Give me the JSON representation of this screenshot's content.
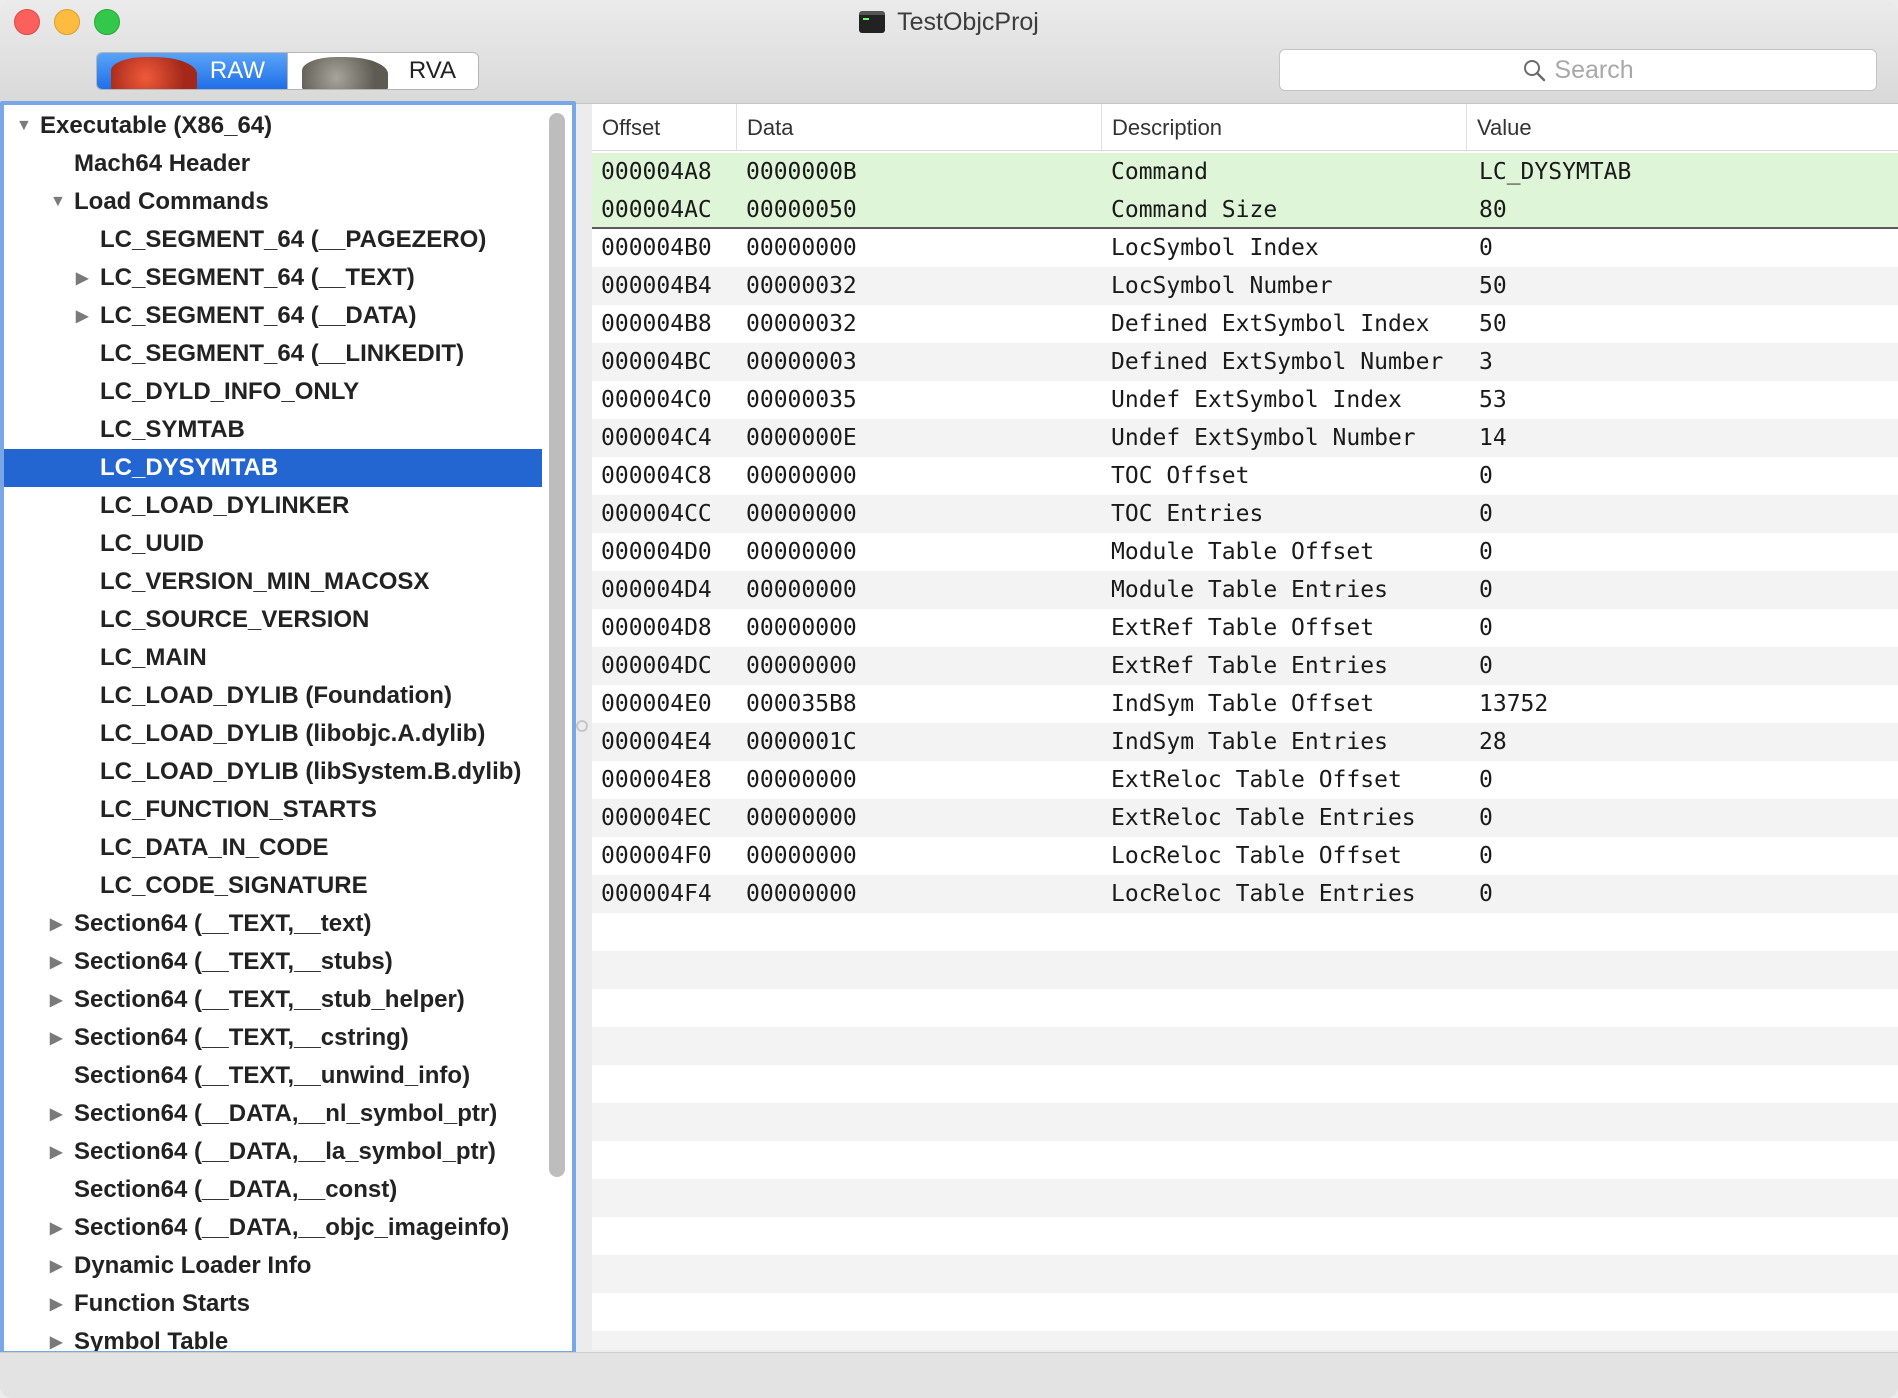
{
  "window": {
    "title": "TestObjcProj"
  },
  "toolbar": {
    "raw_label": "RAW",
    "rva_label": "RVA",
    "search_placeholder": "Search"
  },
  "sidebar": {
    "selected_index": 9,
    "items": [
      {
        "label": "Executable  (X86_64)",
        "level": 0,
        "disclosure": "expanded"
      },
      {
        "label": "Mach64 Header",
        "level": 1,
        "disclosure": "none"
      },
      {
        "label": "Load Commands",
        "level": 1,
        "disclosure": "expanded"
      },
      {
        "label": "LC_SEGMENT_64 (__PAGEZERO)",
        "level": 2,
        "disclosure": "none"
      },
      {
        "label": "LC_SEGMENT_64 (__TEXT)",
        "level": 2,
        "disclosure": "collapsed"
      },
      {
        "label": "LC_SEGMENT_64 (__DATA)",
        "level": 2,
        "disclosure": "collapsed"
      },
      {
        "label": "LC_SEGMENT_64 (__LINKEDIT)",
        "level": 2,
        "disclosure": "none"
      },
      {
        "label": "LC_DYLD_INFO_ONLY",
        "level": 2,
        "disclosure": "none"
      },
      {
        "label": "LC_SYMTAB",
        "level": 2,
        "disclosure": "none"
      },
      {
        "label": "LC_DYSYMTAB",
        "level": 2,
        "disclosure": "none"
      },
      {
        "label": "LC_LOAD_DYLINKER",
        "level": 2,
        "disclosure": "none"
      },
      {
        "label": "LC_UUID",
        "level": 2,
        "disclosure": "none"
      },
      {
        "label": "LC_VERSION_MIN_MACOSX",
        "level": 2,
        "disclosure": "none"
      },
      {
        "label": "LC_SOURCE_VERSION",
        "level": 2,
        "disclosure": "none"
      },
      {
        "label": "LC_MAIN",
        "level": 2,
        "disclosure": "none"
      },
      {
        "label": "LC_LOAD_DYLIB (Foundation)",
        "level": 2,
        "disclosure": "none"
      },
      {
        "label": "LC_LOAD_DYLIB (libobjc.A.dylib)",
        "level": 2,
        "disclosure": "none"
      },
      {
        "label": "LC_LOAD_DYLIB (libSystem.B.dylib)",
        "level": 2,
        "disclosure": "none"
      },
      {
        "label": "LC_FUNCTION_STARTS",
        "level": 2,
        "disclosure": "none"
      },
      {
        "label": "LC_DATA_IN_CODE",
        "level": 2,
        "disclosure": "none"
      },
      {
        "label": "LC_CODE_SIGNATURE",
        "level": 2,
        "disclosure": "none"
      },
      {
        "label": "Section64 (__TEXT,__text)",
        "level": 1,
        "disclosure": "collapsed"
      },
      {
        "label": "Section64 (__TEXT,__stubs)",
        "level": 1,
        "disclosure": "collapsed"
      },
      {
        "label": "Section64 (__TEXT,__stub_helper)",
        "level": 1,
        "disclosure": "collapsed"
      },
      {
        "label": "Section64 (__TEXT,__cstring)",
        "level": 1,
        "disclosure": "collapsed"
      },
      {
        "label": "Section64 (__TEXT,__unwind_info)",
        "level": 1,
        "disclosure": "none"
      },
      {
        "label": "Section64 (__DATA,__nl_symbol_ptr)",
        "level": 1,
        "disclosure": "collapsed"
      },
      {
        "label": "Section64 (__DATA,__la_symbol_ptr)",
        "level": 1,
        "disclosure": "collapsed"
      },
      {
        "label": "Section64 (__DATA,__const)",
        "level": 1,
        "disclosure": "none"
      },
      {
        "label": "Section64 (__DATA,__objc_imageinfo)",
        "level": 1,
        "disclosure": "collapsed"
      },
      {
        "label": "Dynamic Loader Info",
        "level": 1,
        "disclosure": "collapsed"
      },
      {
        "label": "Function Starts",
        "level": 1,
        "disclosure": "collapsed"
      },
      {
        "label": "Symbol Table",
        "level": 1,
        "disclosure": "collapsed"
      }
    ]
  },
  "table": {
    "columns": [
      "Offset",
      "Data",
      "Description",
      "Value"
    ],
    "highlighted_rows": 2,
    "rows": [
      {
        "offset": "000004A8",
        "data": "0000000B",
        "description": "Command",
        "value": "LC_DYSYMTAB"
      },
      {
        "offset": "000004AC",
        "data": "00000050",
        "description": "Command Size",
        "value": "80"
      },
      {
        "offset": "000004B0",
        "data": "00000000",
        "description": "LocSymbol Index",
        "value": "0"
      },
      {
        "offset": "000004B4",
        "data": "00000032",
        "description": "LocSymbol Number",
        "value": "50"
      },
      {
        "offset": "000004B8",
        "data": "00000032",
        "description": "Defined ExtSymbol Index",
        "value": "50"
      },
      {
        "offset": "000004BC",
        "data": "00000003",
        "description": "Defined ExtSymbol Number",
        "value": "3"
      },
      {
        "offset": "000004C0",
        "data": "00000035",
        "description": "Undef ExtSymbol Index",
        "value": "53"
      },
      {
        "offset": "000004C4",
        "data": "0000000E",
        "description": "Undef ExtSymbol Number",
        "value": "14"
      },
      {
        "offset": "000004C8",
        "data": "00000000",
        "description": "TOC Offset",
        "value": "0"
      },
      {
        "offset": "000004CC",
        "data": "00000000",
        "description": "TOC Entries",
        "value": "0"
      },
      {
        "offset": "000004D0",
        "data": "00000000",
        "description": "Module Table Offset",
        "value": "0"
      },
      {
        "offset": "000004D4",
        "data": "00000000",
        "description": "Module Table Entries",
        "value": "0"
      },
      {
        "offset": "000004D8",
        "data": "00000000",
        "description": "ExtRef Table Offset",
        "value": "0"
      },
      {
        "offset": "000004DC",
        "data": "00000000",
        "description": "ExtRef Table Entries",
        "value": "0"
      },
      {
        "offset": "000004E0",
        "data": "000035B8",
        "description": "IndSym Table Offset",
        "value": "13752"
      },
      {
        "offset": "000004E4",
        "data": "0000001C",
        "description": "IndSym Table Entries",
        "value": "28"
      },
      {
        "offset": "000004E8",
        "data": "00000000",
        "description": "ExtReloc Table Offset",
        "value": "0"
      },
      {
        "offset": "000004EC",
        "data": "00000000",
        "description": "ExtReloc Table Entries",
        "value": "0"
      },
      {
        "offset": "000004F0",
        "data": "00000000",
        "description": "LocReloc Table Offset",
        "value": "0"
      },
      {
        "offset": "000004F4",
        "data": "00000000",
        "description": "LocReloc Table Entries",
        "value": "0"
      }
    ]
  },
  "colors": {
    "selection": "#2366d1",
    "highlight_row": "#dff5d7",
    "focus_ring": "#78a6e6"
  }
}
